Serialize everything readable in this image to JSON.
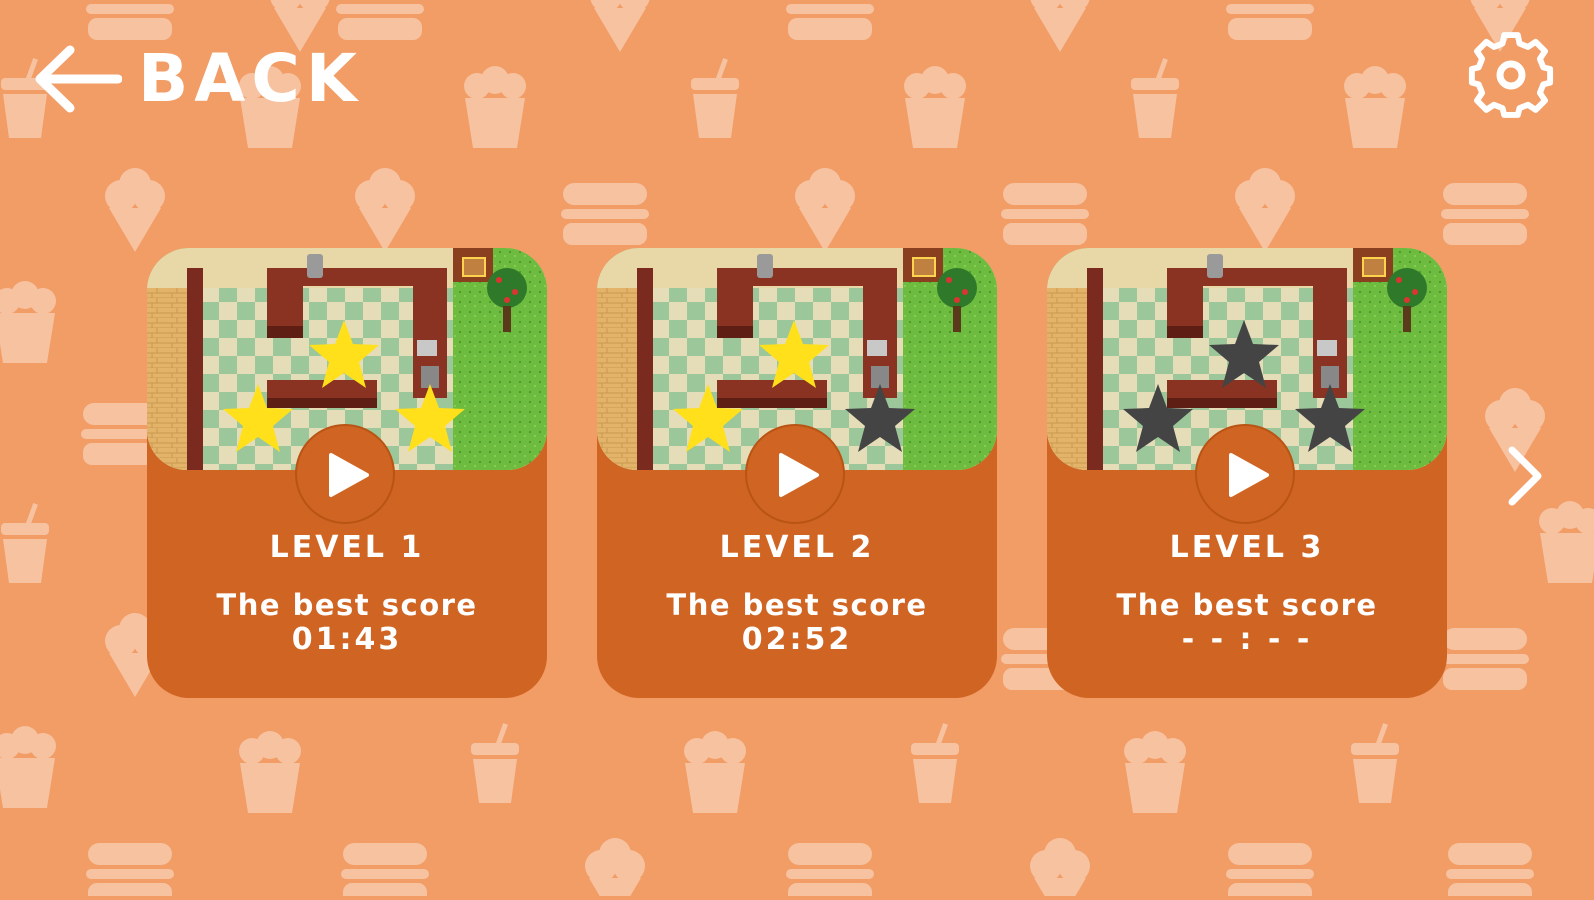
{
  "header": {
    "back_label": "BACK"
  },
  "colors": {
    "background": "#f29c66",
    "card": "#d06422",
    "star_earned": "#ffe01a",
    "star_unearned": "#444444",
    "text": "#ffffff"
  },
  "icons": {
    "back": "arrow-left-icon",
    "settings": "gear-icon",
    "next": "chevron-right-icon",
    "play": "play-icon",
    "star": "star-icon"
  },
  "levels": [
    {
      "title": "LEVEL 1",
      "score_label": "The best score",
      "score": "01:43",
      "stars_earned": 3,
      "stars_total": 3
    },
    {
      "title": "LEVEL 2",
      "score_label": "The best score",
      "score": "02:52",
      "stars_earned": 2,
      "stars_total": 3
    },
    {
      "title": "LEVEL 3",
      "score_label": "The best score",
      "score": "- - : - -",
      "stars_earned": 0,
      "stars_total": 3
    }
  ]
}
